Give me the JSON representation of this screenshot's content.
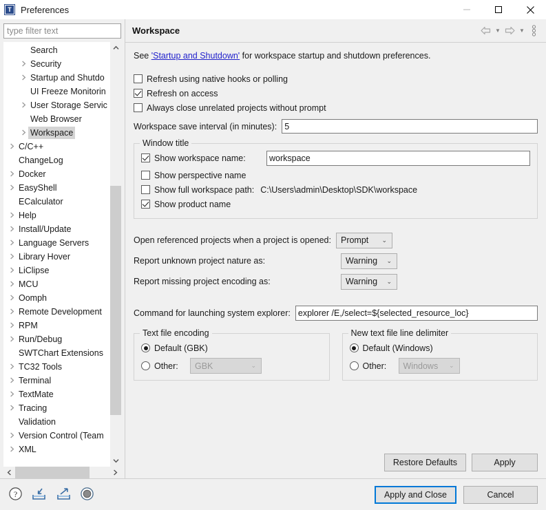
{
  "window": {
    "title": "Preferences",
    "icon": "eclipse-t-icon",
    "controls": {
      "minimize": "minimize-icon",
      "maximize": "maximize-icon",
      "close": "close-icon"
    }
  },
  "sidebar": {
    "filter_placeholder": "type filter text",
    "filter_value": "",
    "selected": "Workspace",
    "items": [
      {
        "label": "Search",
        "level": 2,
        "expandable": false
      },
      {
        "label": "Security",
        "level": 2,
        "expandable": true
      },
      {
        "label": "Startup and Shutdo",
        "level": 2,
        "expandable": true
      },
      {
        "label": "UI Freeze Monitorin",
        "level": 2,
        "expandable": false
      },
      {
        "label": "User Storage Servic",
        "level": 2,
        "expandable": true
      },
      {
        "label": "Web Browser",
        "level": 2,
        "expandable": false
      },
      {
        "label": "Workspace",
        "level": 2,
        "expandable": true
      },
      {
        "label": "C/C++",
        "level": 1,
        "expandable": true
      },
      {
        "label": "ChangeLog",
        "level": 1,
        "expandable": false
      },
      {
        "label": "Docker",
        "level": 1,
        "expandable": true
      },
      {
        "label": "EasyShell",
        "level": 1,
        "expandable": true
      },
      {
        "label": "ECalculator",
        "level": 1,
        "expandable": false
      },
      {
        "label": "Help",
        "level": 1,
        "expandable": true
      },
      {
        "label": "Install/Update",
        "level": 1,
        "expandable": true
      },
      {
        "label": "Language Servers",
        "level": 1,
        "expandable": true
      },
      {
        "label": "Library Hover",
        "level": 1,
        "expandable": true
      },
      {
        "label": "LiClipse",
        "level": 1,
        "expandable": true
      },
      {
        "label": "MCU",
        "level": 1,
        "expandable": true
      },
      {
        "label": "Oomph",
        "level": 1,
        "expandable": true
      },
      {
        "label": "Remote Development",
        "level": 1,
        "expandable": true
      },
      {
        "label": "RPM",
        "level": 1,
        "expandable": true
      },
      {
        "label": "Run/Debug",
        "level": 1,
        "expandable": true
      },
      {
        "label": "SWTChart Extensions",
        "level": 1,
        "expandable": false
      },
      {
        "label": "TC32 Tools",
        "level": 1,
        "expandable": true
      },
      {
        "label": "Terminal",
        "level": 1,
        "expandable": true
      },
      {
        "label": "TextMate",
        "level": 1,
        "expandable": true
      },
      {
        "label": "Tracing",
        "level": 1,
        "expandable": true
      },
      {
        "label": "Validation",
        "level": 1,
        "expandable": false
      },
      {
        "label": "Version Control (Team",
        "level": 1,
        "expandable": true
      },
      {
        "label": "XML",
        "level": 1,
        "expandable": true
      }
    ]
  },
  "page": {
    "title": "Workspace",
    "toolbar": {
      "back": "back-arrow-icon",
      "back_menu": "chevron-down-icon",
      "forward": "forward-arrow-icon",
      "forward_menu": "chevron-down-icon",
      "overflow": "view-menu-icon"
    },
    "description": {
      "prefix": "See ",
      "link": "'Startup and Shutdown'",
      "suffix": " for workspace startup and shutdown preferences."
    },
    "checkboxes": [
      {
        "label": "Refresh using native hooks or polling",
        "checked": false
      },
      {
        "label": "Refresh on access",
        "checked": true
      },
      {
        "label": "Always close unrelated projects without prompt",
        "checked": false
      }
    ],
    "save_interval": {
      "label": "Workspace save interval (in minutes):",
      "value": "5"
    },
    "window_title_group": {
      "title": "Window title",
      "show_workspace_name": {
        "label": "Show workspace name:",
        "checked": true,
        "value": "workspace"
      },
      "show_perspective_name": {
        "label": "Show perspective name",
        "checked": false
      },
      "show_full_workspace_path": {
        "label": "Show full workspace path:",
        "checked": false,
        "value": "C:\\Users\\admin\\Desktop\\SDK\\workspace"
      },
      "show_product_name": {
        "label": "Show product name",
        "checked": true
      }
    },
    "selects": [
      {
        "label": "Open referenced projects when a project is opened:",
        "value": "Prompt"
      },
      {
        "label": "Report unknown project nature as:",
        "value": "Warning"
      },
      {
        "label": "Report missing project encoding as:",
        "value": "Warning"
      }
    ],
    "explorer_command": {
      "label": "Command for launching system explorer:",
      "value": "explorer /E,/select=${selected_resource_loc}"
    },
    "text_file_encoding": {
      "title": "Text file encoding",
      "default_label": "Default (GBK)",
      "default_selected": true,
      "other_label": "Other:",
      "other_selected": false,
      "other_value": "GBK",
      "other_disabled": true
    },
    "line_delimiter": {
      "title": "New text file line delimiter",
      "default_label": "Default (Windows)",
      "default_selected": true,
      "other_label": "Other:",
      "other_selected": false,
      "other_value": "Windows",
      "other_disabled": true
    },
    "restore_defaults_label": "Restore Defaults",
    "apply_label": "Apply"
  },
  "footer": {
    "icons": [
      {
        "name": "help-icon"
      },
      {
        "name": "import-preferences-icon"
      },
      {
        "name": "export-preferences-icon"
      },
      {
        "name": "oomph-record-icon"
      }
    ],
    "apply_and_close_label": "Apply and Close",
    "cancel_label": "Cancel"
  },
  "colors": {
    "accent": "#0078d7",
    "link": "#2222cc",
    "dialog_bg": "#f0f0f0",
    "selection_bg": "#d4d4d4"
  }
}
